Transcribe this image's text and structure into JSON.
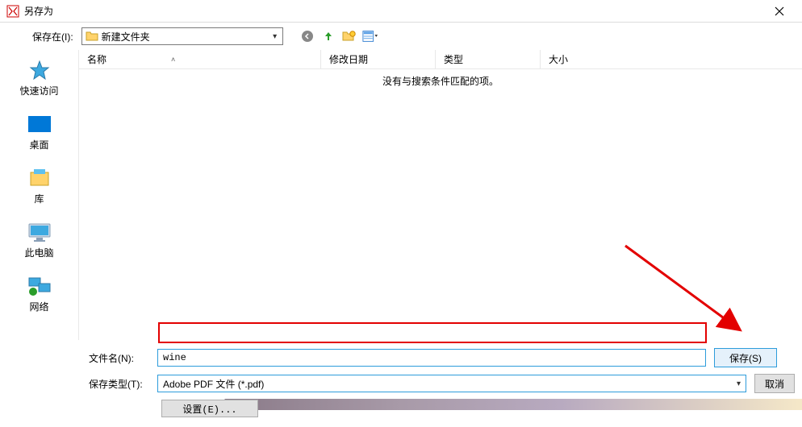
{
  "titlebar": {
    "title": "另存为"
  },
  "topbar": {
    "save_in_label": "保存在(I):",
    "location": "新建文件夹"
  },
  "sidebar": {
    "items": [
      {
        "label": "快速访问"
      },
      {
        "label": "桌面"
      },
      {
        "label": "库"
      },
      {
        "label": "此电脑"
      },
      {
        "label": "网络"
      }
    ]
  },
  "file_headers": {
    "name": "名称",
    "date": "修改日期",
    "type": "类型",
    "size": "大小"
  },
  "empty_message": "没有与搜索条件匹配的项。",
  "bottom": {
    "filename_label": "文件名(N):",
    "filename_value": "wine",
    "filetype_label": "保存类型(T):",
    "filetype_value": "Adobe PDF 文件 (*.pdf)",
    "save_label": "保存(S)",
    "cancel_label": "取消",
    "settings_label": "设置(E)..."
  }
}
